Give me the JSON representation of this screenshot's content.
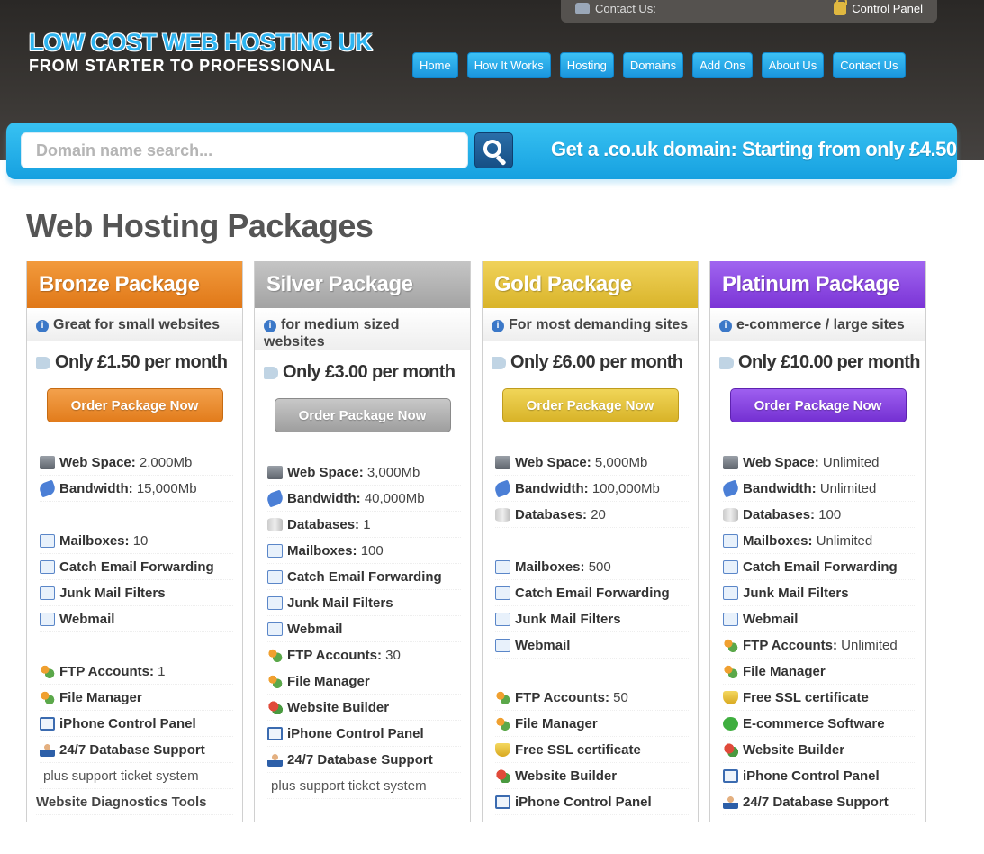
{
  "topbar": {
    "contact_label": "Contact Us:",
    "control_panel_label": "Control Panel"
  },
  "logo": {
    "title": "LOW COST WEB HOSTING UK",
    "subtitle": "FROM STARTER TO PROFESSIONAL"
  },
  "nav": [
    "Home",
    "How It Works",
    "Hosting",
    "Domains",
    "Add Ons",
    "About Us",
    "Contact Us"
  ],
  "search": {
    "placeholder": "Domain name search...",
    "promo": "Get a .co.uk domain: Starting from only £4.50"
  },
  "page_title": "Web Hosting Packages",
  "packages": [
    {
      "name": "Bronze Package",
      "tagline": "Great for small websites",
      "price": "Only £1.50 per month",
      "order": "Order Package Now",
      "features": [
        {
          "icon": "server-icon",
          "label": "Web Space:",
          "value": " 2,000Mb"
        },
        {
          "icon": "cable-icon",
          "label": "Bandwidth:",
          "value": " 15,000Mb"
        },
        {
          "gap": true
        },
        {
          "icon": "mail-icon",
          "label": "Mailboxes:",
          "value": " 10"
        },
        {
          "icon": "mail-icon",
          "label": "Catch Email Forwarding",
          "value": ""
        },
        {
          "icon": "mail-icon",
          "label": "Junk Mail Filters",
          "value": ""
        },
        {
          "icon": "mail-icon",
          "label": "Webmail",
          "value": ""
        },
        {
          "gap": true
        },
        {
          "icon": "users-icon",
          "label": "FTP Accounts:",
          "value": " 1"
        },
        {
          "icon": "users-icon",
          "label": "File Manager",
          "value": ""
        },
        {
          "icon": "phone-icon",
          "label": "iPhone Control Panel",
          "value": ""
        },
        {
          "icon": "person-icon",
          "label": "24/7 Database Support",
          "value": ""
        },
        {
          "plain": "plus support ticket system"
        },
        {
          "heading": "Website Diagnostics Tools"
        }
      ]
    },
    {
      "name": "Silver Package",
      "tagline": "for medium sized websites",
      "price": "Only £3.00 per month",
      "order": "Order Package Now",
      "features": [
        {
          "icon": "server-icon",
          "label": "Web Space:",
          "value": " 3,000Mb"
        },
        {
          "icon": "cable-icon",
          "label": "Bandwidth:",
          "value": " 40,000Mb"
        },
        {
          "icon": "database-icon",
          "label": "Databases:",
          "value": " 1"
        },
        {
          "icon": "mail-icon",
          "label": "Mailboxes:",
          "value": " 100"
        },
        {
          "icon": "mail-icon",
          "label": "Catch Email Forwarding",
          "value": ""
        },
        {
          "icon": "mail-icon",
          "label": "Junk Mail Filters",
          "value": ""
        },
        {
          "icon": "mail-icon",
          "label": "Webmail",
          "value": ""
        },
        {
          "icon": "users-icon",
          "label": "FTP Accounts:",
          "value": " 30"
        },
        {
          "icon": "users-icon",
          "label": "File Manager",
          "value": ""
        },
        {
          "icon": "builder-icon",
          "label": "Website Builder",
          "value": ""
        },
        {
          "icon": "phone-icon",
          "label": "iPhone Control Panel",
          "value": ""
        },
        {
          "icon": "person-icon",
          "label": "24/7 Database Support",
          "value": ""
        },
        {
          "plain": "plus support ticket system"
        }
      ]
    },
    {
      "name": "Gold Package",
      "tagline": "For most demanding sites",
      "price": "Only £6.00 per month",
      "order": "Order Package Now",
      "features": [
        {
          "icon": "server-icon",
          "label": "Web Space:",
          "value": " 5,000Mb"
        },
        {
          "icon": "cable-icon",
          "label": "Bandwidth:",
          "value": " 100,000Mb"
        },
        {
          "icon": "database-icon",
          "label": "Databases:",
          "value": " 20"
        },
        {
          "gap": true
        },
        {
          "icon": "mail-icon",
          "label": "Mailboxes:",
          "value": " 500"
        },
        {
          "icon": "mail-icon",
          "label": "Catch Email Forwarding",
          "value": ""
        },
        {
          "icon": "mail-icon",
          "label": "Junk Mail Filters",
          "value": ""
        },
        {
          "icon": "mail-icon",
          "label": "Webmail",
          "value": ""
        },
        {
          "gap": true
        },
        {
          "icon": "users-icon",
          "label": "FTP Accounts:",
          "value": " 50"
        },
        {
          "icon": "users-icon",
          "label": "File Manager",
          "value": ""
        },
        {
          "icon": "shield-icon",
          "label": "Free SSL certificate",
          "value": ""
        },
        {
          "icon": "builder-icon",
          "label": "Website Builder",
          "value": ""
        },
        {
          "icon": "phone-icon",
          "label": "iPhone Control Panel",
          "value": ""
        }
      ]
    },
    {
      "name": "Platinum Package",
      "tagline": "e-commerce / large sites",
      "price": "Only £10.00 per month",
      "order": "Order Package Now",
      "features": [
        {
          "icon": "server-icon",
          "label": "Web Space:",
          "value": " Unlimited"
        },
        {
          "icon": "cable-icon",
          "label": "Bandwidth:",
          "value": " Unlimited"
        },
        {
          "icon": "database-icon",
          "label": "Databases:",
          "value": " 100"
        },
        {
          "icon": "mail-icon",
          "label": "Mailboxes:",
          "value": " Unlimited"
        },
        {
          "icon": "mail-icon",
          "label": "Catch Email Forwarding",
          "value": ""
        },
        {
          "icon": "mail-icon",
          "label": "Junk Mail Filters",
          "value": ""
        },
        {
          "icon": "mail-icon",
          "label": "Webmail",
          "value": ""
        },
        {
          "icon": "users-icon",
          "label": "FTP Accounts:",
          "value": " Unlimited"
        },
        {
          "icon": "users-icon",
          "label": "File Manager",
          "value": ""
        },
        {
          "icon": "shield-icon",
          "label": "Free SSL certificate",
          "value": ""
        },
        {
          "icon": "check-icon",
          "label": "E-commerce Software",
          "value": ""
        },
        {
          "icon": "builder-icon",
          "label": "Website Builder",
          "value": ""
        },
        {
          "icon": "phone-icon",
          "label": "iPhone Control Panel",
          "value": ""
        },
        {
          "icon": "person-icon",
          "label": "24/7 Database Support",
          "value": ""
        }
      ]
    }
  ]
}
